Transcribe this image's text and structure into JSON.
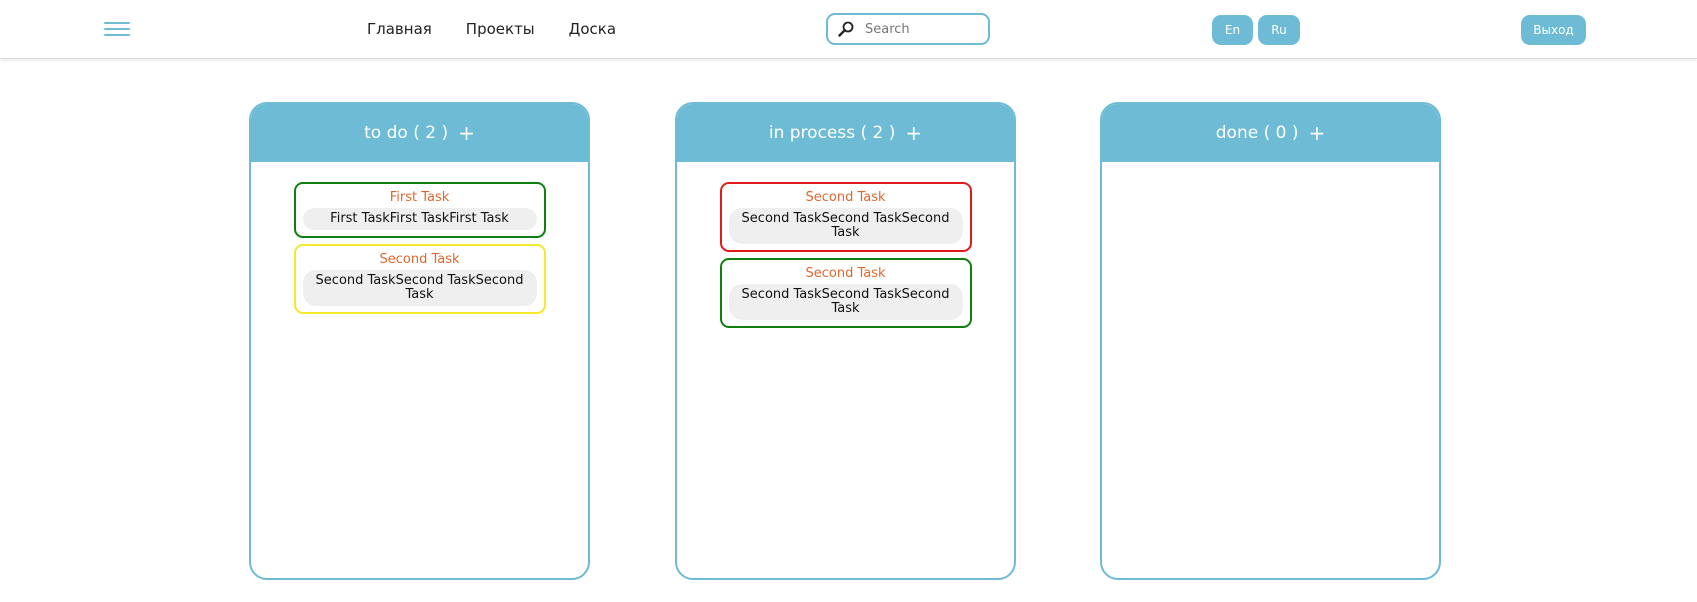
{
  "nav": {
    "items": [
      "Главная",
      "Проекты",
      "Доска"
    ]
  },
  "search": {
    "placeholder": "Search",
    "value": ""
  },
  "lang": {
    "en": "En",
    "ru": "Ru"
  },
  "logout_label": "Выход",
  "colors": {
    "accent": "#6dbbd4",
    "task_title": "#e0682f"
  },
  "columns": [
    {
      "title": "to do ( 2 )",
      "add": "+",
      "tasks": [
        {
          "title": "First Task",
          "desc": "First TaskFirst TaskFirst Task",
          "border": "#0f7f0f"
        },
        {
          "title": "Second Task",
          "desc": "Second TaskSecond TaskSecond Task",
          "border": "#f4e92a"
        }
      ]
    },
    {
      "title": "in process ( 2 )",
      "add": "+",
      "tasks": [
        {
          "title": "Second Task",
          "desc": "Second TaskSecond TaskSecond Task",
          "border": "#e01b1b"
        },
        {
          "title": "Second Task",
          "desc": "Second TaskSecond TaskSecond Task",
          "border": "#0f7f0f"
        }
      ]
    },
    {
      "title": "done ( 0 )",
      "add": "+",
      "tasks": []
    }
  ]
}
